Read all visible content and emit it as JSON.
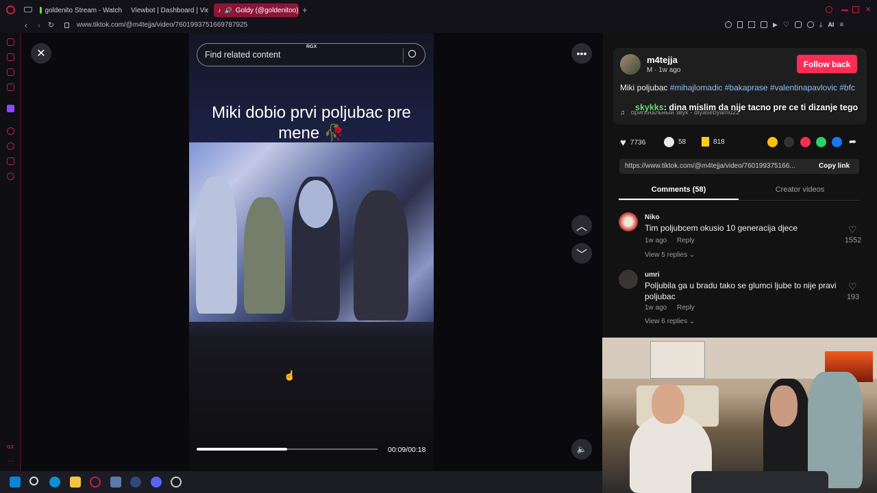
{
  "browser": {
    "tabs": [
      {
        "label": "goldenito Stream - Watch"
      },
      {
        "label": "Viewbot | Dashboard | Vie"
      },
      {
        "label": "Goldy (@goldenitoo) |"
      }
    ],
    "url": "www.tiktok.com/@m4tejja/video/7601993751669787925"
  },
  "player": {
    "search_placeholder": "Find related content",
    "search_badge": "RGX",
    "caption": "Miki dobio prvi poljubac pre mene 🥀",
    "time": "00:09/00:18",
    "progress": 0.5
  },
  "post": {
    "author": "m4tejja",
    "author_sub": "M · 1w ago",
    "follow_label": "Follow back",
    "desc_text": "Miki poljubac ",
    "tags": [
      "#mihajlomadic",
      "#bakaprase",
      "#valentinapavlovic",
      "#bfc"
    ],
    "music": "оригинальный звук - diyasebyamu22",
    "likes": "7736",
    "comments": "58",
    "saves": "818",
    "link": "https://www.tiktok.com/@m4tejja/video/760199375166...",
    "copy_link_label": "Copy link"
  },
  "chat_overlay": {
    "user": "skykks",
    "message": ": dina mislim da nije tacno pre ce ti dizanje tego"
  },
  "tabs": {
    "comments": "Comments (58)",
    "creator": "Creator videos"
  },
  "comments": [
    {
      "name": "Niko",
      "text": "Tim poljubcem okusio 10 generacija djece",
      "time": "1w ago",
      "reply": "Reply",
      "replies": "View 5 replies",
      "likes": "1552"
    },
    {
      "name": "umri",
      "text": "Poljubila ga u bradu tako se glumci ljube to nije pravi poljubac",
      "time": "1w ago",
      "reply": "Reply",
      "replies": "View 6 replies",
      "likes": "193"
    }
  ],
  "colors": {
    "accent": "#fe2c55",
    "opera_red": "#c3204a",
    "tag": "#8fbef5"
  }
}
